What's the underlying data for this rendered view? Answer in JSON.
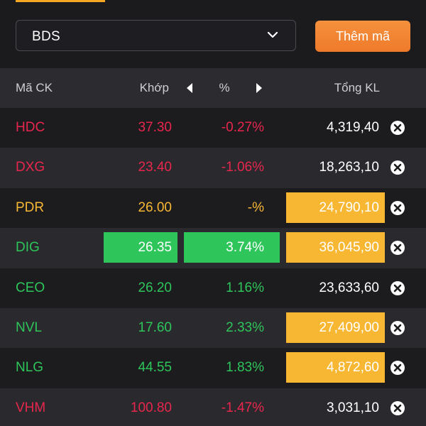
{
  "toolbar": {
    "watchlist_value": "BDS",
    "add_button_label": "Thêm mã"
  },
  "header": {
    "symbol": "Mã CK",
    "match": "Khớp",
    "percent": "%",
    "volume": "Tổng KL"
  },
  "icons": {
    "dropdown": "chevron-down-icon",
    "prev": "caret-left-icon",
    "next": "caret-right-icon",
    "remove": "close-circle-icon"
  },
  "colors": {
    "up": "#2ec55a",
    "down": "#e8264d",
    "reference": "#f8b733",
    "accent": "#f5913d"
  },
  "rows": [
    {
      "symbol": "HDC",
      "price": "37.30",
      "change": "-0.27%",
      "volume": "4,319,40",
      "status": "down",
      "price_hl": false,
      "change_hl": false,
      "volume_hl": false
    },
    {
      "symbol": "DXG",
      "price": "23.40",
      "change": "-1.06%",
      "volume": "18,263,10",
      "status": "down",
      "price_hl": false,
      "change_hl": false,
      "volume_hl": false
    },
    {
      "symbol": "PDR",
      "price": "26.00",
      "change": "-%",
      "volume": "24,790,10",
      "status": "ref",
      "price_hl": false,
      "change_hl": false,
      "volume_hl": true
    },
    {
      "symbol": "DIG",
      "price": "26.35",
      "change": "3.74%",
      "volume": "36,045,90",
      "status": "up",
      "price_hl": true,
      "change_hl": true,
      "volume_hl": true
    },
    {
      "symbol": "CEO",
      "price": "26.20",
      "change": "1.16%",
      "volume": "23,633,60",
      "status": "up",
      "price_hl": false,
      "change_hl": false,
      "volume_hl": false
    },
    {
      "symbol": "NVL",
      "price": "17.60",
      "change": "2.33%",
      "volume": "27,409,00",
      "status": "up",
      "price_hl": false,
      "change_hl": false,
      "volume_hl": true
    },
    {
      "symbol": "NLG",
      "price": "44.55",
      "change": "1.83%",
      "volume": "4,872,60",
      "status": "up",
      "price_hl": false,
      "change_hl": false,
      "volume_hl": true
    },
    {
      "symbol": "VHM",
      "price": "100.80",
      "change": "-1.47%",
      "volume": "3,031,10",
      "status": "down",
      "price_hl": false,
      "change_hl": false,
      "volume_hl": false
    }
  ]
}
